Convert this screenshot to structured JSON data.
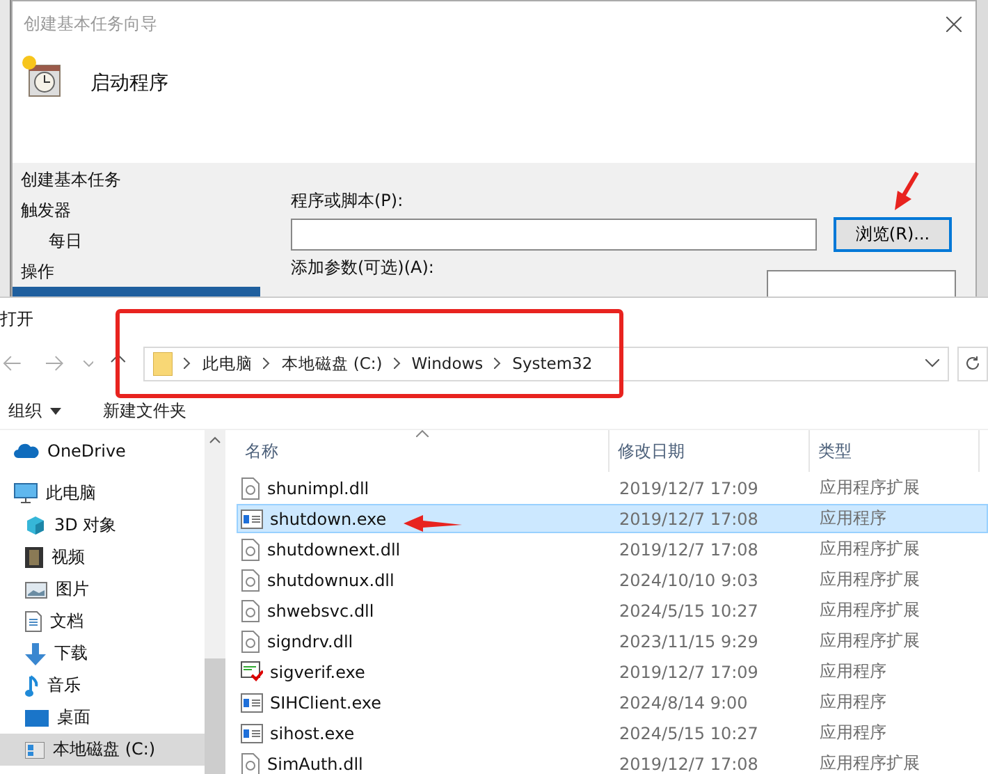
{
  "task_wizard": {
    "title": "创建基本任务向导",
    "header": "启动程序",
    "steps": [
      {
        "label": "创建基本任务",
        "selected": false
      },
      {
        "label": "触发器",
        "selected": false,
        "children": [
          {
            "label": "每日",
            "selected": false
          }
        ]
      },
      {
        "label": "操作",
        "selected": false,
        "children": [
          {
            "selected": true
          }
        ]
      }
    ],
    "program_label": "程序或脚本(P):",
    "browse_button": {
      "label": "浏览(R)...",
      "focused": true
    },
    "args_label": "添加参数(可选)(A):"
  },
  "open_dialog": {
    "title": "打开",
    "breadcrumbs": [
      "此电脑",
      "本地磁盘 (C:)",
      "Windows",
      "System32"
    ],
    "toolbar": {
      "organize": "组织",
      "new_folder": "新建文件夹"
    },
    "nav": [
      {
        "label": "OneDrive",
        "kind": "cloud",
        "selected": false
      },
      {
        "label": "此电脑",
        "kind": "pc",
        "selected": false,
        "children": [
          {
            "label": "3D 对象",
            "kind": "cube",
            "selected": false
          },
          {
            "label": "视频",
            "kind": "film",
            "selected": false
          },
          {
            "label": "图片",
            "kind": "image",
            "selected": false
          },
          {
            "label": "文档",
            "kind": "doc",
            "selected": false
          },
          {
            "label": "下载",
            "kind": "download",
            "selected": false
          },
          {
            "label": "音乐",
            "kind": "music",
            "selected": false
          },
          {
            "label": "桌面",
            "kind": "desktop",
            "selected": false
          },
          {
            "label": "本地磁盘 (C:)",
            "kind": "drive",
            "selected": true
          }
        ]
      }
    ],
    "columns": [
      "名称",
      "修改日期",
      "类型"
    ],
    "files": [
      {
        "name": "shunimpl.dll",
        "date": "2019/12/7 17:09",
        "type": "应用程序扩展",
        "kind": "dll",
        "selected": false
      },
      {
        "name": "shutdown.exe",
        "date": "2019/12/7 17:08",
        "type": "应用程序",
        "kind": "exe",
        "selected": true
      },
      {
        "name": "shutdownext.dll",
        "date": "2019/12/7 17:08",
        "type": "应用程序扩展",
        "kind": "dll",
        "selected": false
      },
      {
        "name": "shutdownux.dll",
        "date": "2024/10/10 9:03",
        "type": "应用程序扩展",
        "kind": "dll",
        "selected": false
      },
      {
        "name": "shwebsvc.dll",
        "date": "2024/5/15 10:27",
        "type": "应用程序扩展",
        "kind": "dll",
        "selected": false
      },
      {
        "name": "signdrv.dll",
        "date": "2023/11/15 9:29",
        "type": "应用程序扩展",
        "kind": "dll",
        "selected": false
      },
      {
        "name": "sigverif.exe",
        "date": "2019/12/7 17:09",
        "type": "应用程序",
        "kind": "check",
        "selected": false
      },
      {
        "name": "SIHClient.exe",
        "date": "2024/8/14 9:00",
        "type": "应用程序",
        "kind": "exe",
        "selected": false
      },
      {
        "name": "sihost.exe",
        "date": "2024/5/15 10:27",
        "type": "应用程序",
        "kind": "exe",
        "selected": false
      },
      {
        "name": "SimAuth.dll",
        "date": "2019/12/7 17:08",
        "type": "应用程序扩展",
        "kind": "dll",
        "selected": false
      }
    ]
  }
}
